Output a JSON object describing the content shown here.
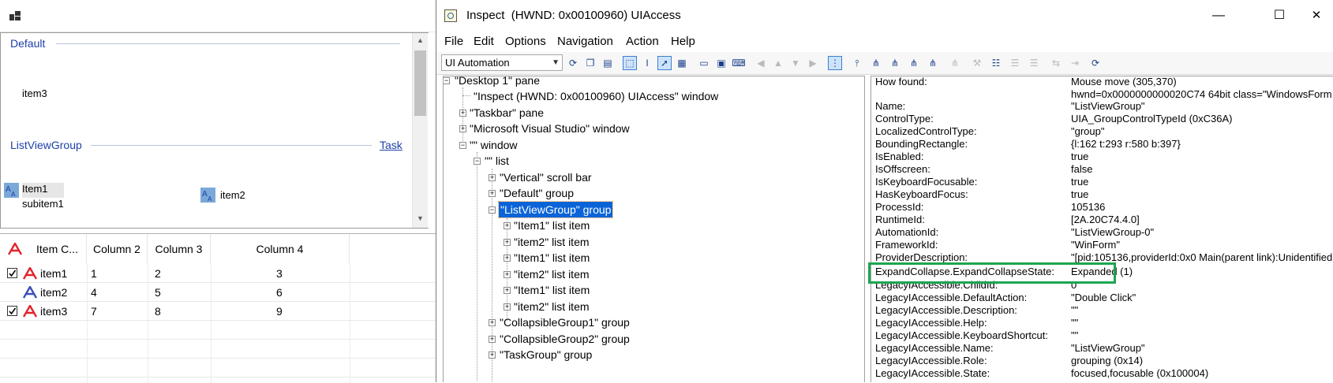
{
  "left_app": {
    "top_list": {
      "groups": [
        {
          "header": "Default",
          "items": [
            {
              "label": "item3"
            }
          ]
        },
        {
          "header": "ListViewGroup",
          "task": "Task",
          "items": [
            {
              "label": "Item1",
              "sub": "subitem1"
            },
            {
              "label": "item2"
            }
          ]
        }
      ]
    },
    "details": {
      "columns": [
        "Item C...",
        "Column 2",
        "Column 3",
        "Column 4"
      ],
      "rows": [
        {
          "checked": true,
          "icon": "red-a-icon",
          "cells": [
            "item1",
            "1",
            "2",
            "3"
          ]
        },
        {
          "checked": false,
          "icon": "blue-a-icon",
          "cells": [
            "item2",
            "4",
            "5",
            "6"
          ]
        },
        {
          "checked": true,
          "icon": "red-a-icon",
          "cells": [
            "item3",
            "7",
            "8",
            "9"
          ]
        }
      ]
    }
  },
  "inspect": {
    "title": "Inspect  (HWND: 0x00100960) UIAccess",
    "window_buttons": {
      "minimize": "—",
      "maximize": "☐",
      "close": "✕"
    },
    "menu": [
      "File",
      "Edit",
      "Options",
      "Navigation",
      "Action",
      "Help"
    ],
    "mode": "UI Automation",
    "tree": [
      {
        "label": "\"Desktop 1\" pane"
      },
      {
        "label": "\"Inspect  (HWND: 0x00100960) UIAccess\" window"
      },
      {
        "label": "\"Taskbar\" pane"
      },
      {
        "label": "\"Microsoft Visual Studio\" window"
      },
      {
        "label": "\"\" window"
      },
      {
        "label": "\"\" list"
      },
      {
        "label": "\"Vertical\" scroll bar"
      },
      {
        "label": "\"Default\" group"
      },
      {
        "label": "\"ListViewGroup\" group"
      },
      {
        "label": "\"Item1\" list item"
      },
      {
        "label": "\"item2\" list item"
      },
      {
        "label": "\"Item1\" list item"
      },
      {
        "label": "\"item2\" list item"
      },
      {
        "label": "\"Item1\" list item"
      },
      {
        "label": "\"item2\" list item"
      },
      {
        "label": "\"CollapsibleGroup1\" group"
      },
      {
        "label": "\"CollapsibleGroup2\" group"
      },
      {
        "label": "\"TaskGroup\" group"
      }
    ],
    "properties": [
      {
        "name": "How found:",
        "value": "Mouse move (305,370)"
      },
      {
        "name": "",
        "value": "hwnd=0x0000000000020C74 64bit class=\"WindowsForm"
      },
      {
        "name": "Name:",
        "value": "\"ListViewGroup\""
      },
      {
        "name": "ControlType:",
        "value": "UIA_GroupControlTypeId (0xC36A)"
      },
      {
        "name": "LocalizedControlType:",
        "value": "\"group\""
      },
      {
        "name": "BoundingRectangle:",
        "value": "{l:162 t:293 r:580 b:397}"
      },
      {
        "name": "IsEnabled:",
        "value": "true"
      },
      {
        "name": "IsOffscreen:",
        "value": "false"
      },
      {
        "name": "IsKeyboardFocusable:",
        "value": "true"
      },
      {
        "name": "HasKeyboardFocus:",
        "value": "true"
      },
      {
        "name": "ProcessId:",
        "value": "105136"
      },
      {
        "name": "RuntimeId:",
        "value": "[2A.20C74.4.0]"
      },
      {
        "name": "AutomationId:",
        "value": "\"ListViewGroup-0\""
      },
      {
        "name": "FrameworkId:",
        "value": "\"WinForm\""
      },
      {
        "name": "ProviderDescription:",
        "value": "\"[pid:105136,providerId:0x0 Main(parent link):Unidentified"
      },
      {
        "name": "ExpandCollapse.ExpandCollapseState:",
        "value": "Expanded (1)"
      },
      {
        "name": "LegacyIAccessible.ChildId:",
        "value": "0"
      },
      {
        "name": "LegacyIAccessible.DefaultAction:",
        "value": "\"Double Click\""
      },
      {
        "name": "LegacyIAccessible.Description:",
        "value": "\"\""
      },
      {
        "name": "LegacyIAccessible.Help:",
        "value": "\"\""
      },
      {
        "name": "LegacyIAccessible.KeyboardShortcut:",
        "value": "\"\""
      },
      {
        "name": "LegacyIAccessible.Name:",
        "value": "\"ListViewGroup\""
      },
      {
        "name": "LegacyIAccessible.Role:",
        "value": "grouping (0x14)"
      },
      {
        "name": "LegacyIAccessible.State:",
        "value": "focused,focusable (0x100004)"
      }
    ]
  },
  "colors": {
    "accent_selection": "#0a64d8",
    "highlight_box": "#1da550",
    "group_header": "#1e3fa8"
  }
}
